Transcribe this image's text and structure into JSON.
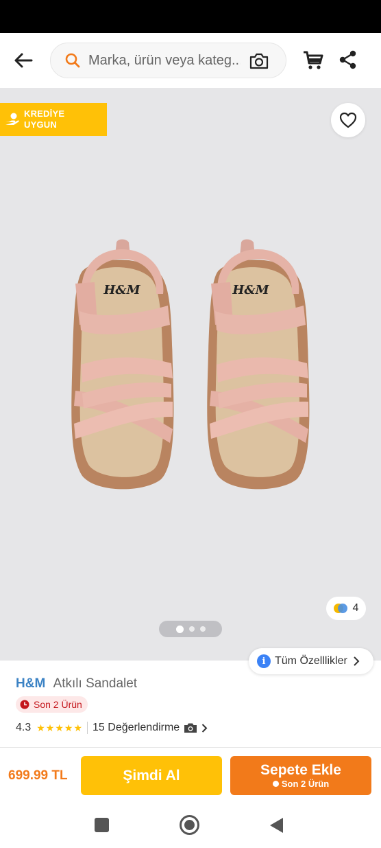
{
  "search": {
    "placeholder": "Marka, ürün veya kateg..."
  },
  "icons": {
    "back": "arrow-left-icon",
    "search": "search-icon",
    "camera": "camera-icon",
    "cart": "cart-icon",
    "share": "share-icon",
    "favorite": "heart-icon",
    "credit": "hand-coin-icon",
    "info": "info-icon"
  },
  "gallery": {
    "credit_badge": [
      "KREDİYE",
      "UYGUN"
    ],
    "product_logo": "H&M",
    "color_count": "4",
    "image_count": 3,
    "active_image": 1
  },
  "specs_button": {
    "label": "Tüm Özelllikler"
  },
  "product": {
    "brand": "H&M",
    "name": "Atkılı Sandalet",
    "stock_badge": "Son 2 Ürün",
    "rating": "4.3",
    "stars": "★★★★★",
    "reviews": "15 Değerlendirme"
  },
  "bottom_bar": {
    "price": "699.99 TL",
    "buy_now": "Şimdi Al",
    "add_to_cart": "Sepete Ekle",
    "add_to_cart_sub": "Son 2 Ürün"
  },
  "colors": {
    "brand_orange": "#f27a1a",
    "accent_yellow": "#ffc107",
    "brand_blue": "#3b82c4",
    "stock_red": "#c4161c",
    "gallery_bg": "#e6e6e8"
  }
}
